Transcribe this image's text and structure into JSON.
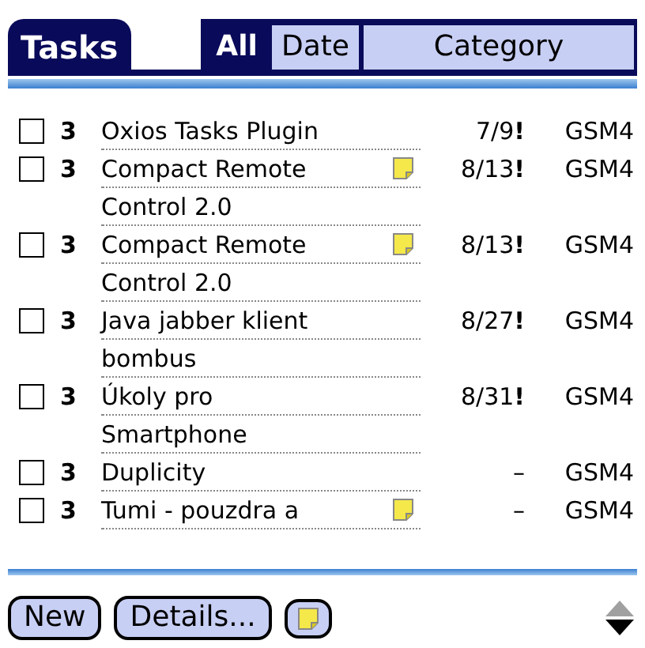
{
  "title": "Tasks",
  "tabs": [
    {
      "label": "All",
      "selected": true
    },
    {
      "label": "Date",
      "selected": false
    },
    {
      "label": "Category",
      "selected": false
    }
  ],
  "tasks": [
    {
      "checked": false,
      "priority": "3",
      "name_lines": [
        "Oxios Tasks Plugin"
      ],
      "note": false,
      "due": "7/9**!**",
      "category": "GSM4"
    },
    {
      "checked": false,
      "priority": "3",
      "name_lines": [
        "Compact Remote",
        "Control 2.0"
      ],
      "note": true,
      "due": "8/13**!**",
      "category": "GSM4"
    },
    {
      "checked": false,
      "priority": "3",
      "name_lines": [
        "Compact Remote",
        "Control 2.0"
      ],
      "note": true,
      "due": "8/13**!**",
      "category": "GSM4"
    },
    {
      "checked": false,
      "priority": "3",
      "name_lines": [
        "Java jabber klient",
        "bombus"
      ],
      "note": false,
      "due": "8/27**!**",
      "category": "GSM4"
    },
    {
      "checked": false,
      "priority": "3",
      "name_lines": [
        "Úkoly pro",
        "Smartphone"
      ],
      "note": false,
      "due": "8/31**!**",
      "category": "GSM4"
    },
    {
      "checked": false,
      "priority": "3",
      "name_lines": [
        "Duplicity"
      ],
      "note": false,
      "due": "–",
      "category": "GSM4"
    },
    {
      "checked": false,
      "priority": "3",
      "name_lines": [
        "Tumi - pouzdra a"
      ],
      "note": true,
      "due": "–",
      "category": "GSM4"
    }
  ],
  "buttons": [
    {
      "kind": "text",
      "label": "New"
    },
    {
      "kind": "text",
      "label": "Details..."
    },
    {
      "kind": "note"
    }
  ],
  "scroll": {
    "up_disabled": true,
    "down_disabled": false
  }
}
